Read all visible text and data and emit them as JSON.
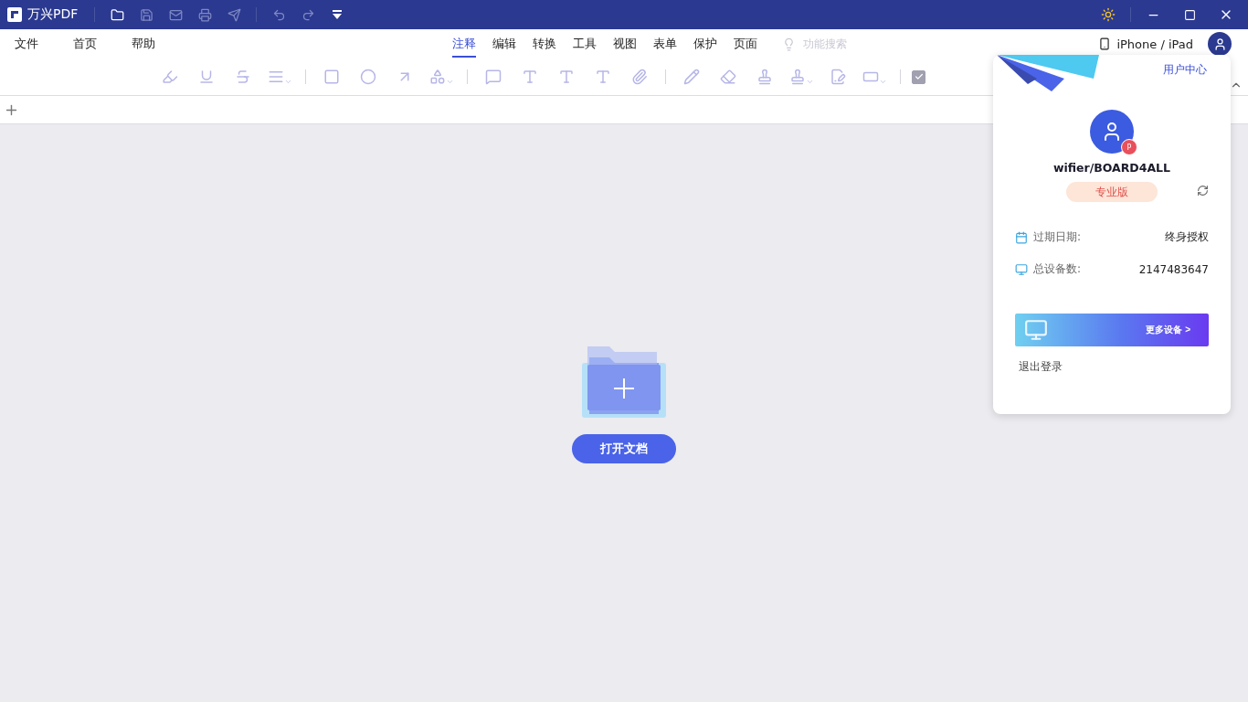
{
  "window": {
    "app_name": "万兴PDF"
  },
  "menu": {
    "left": [
      {
        "label": "文件"
      },
      {
        "label": "首页"
      },
      {
        "label": "帮助"
      }
    ],
    "tabs": [
      {
        "label": "注释",
        "selected": true
      },
      {
        "label": "编辑",
        "selected": false
      },
      {
        "label": "转换",
        "selected": false
      },
      {
        "label": "工具",
        "selected": false
      },
      {
        "label": "视图",
        "selected": false
      },
      {
        "label": "表单",
        "selected": false
      },
      {
        "label": "保护",
        "selected": false
      },
      {
        "label": "页面",
        "selected": false
      }
    ],
    "search": {
      "placeholder": "功能搜索"
    },
    "device_link": "iPhone / iPad"
  },
  "toolbar": {
    "checkbox": {
      "checked": true
    }
  },
  "empty_state": {
    "button": "打开文档"
  },
  "user_popup": {
    "link": "用户中心",
    "badge_letter": "P",
    "username": "wifier/BOARD4ALL",
    "edition": "专业版",
    "rows": [
      {
        "kind": "calendar",
        "label": "过期日期:",
        "value": "终身授权"
      },
      {
        "kind": "monitor",
        "label": "总设备数:",
        "value": "2147483647"
      }
    ],
    "banner": "更多设备 >",
    "logout": "退出登录"
  }
}
